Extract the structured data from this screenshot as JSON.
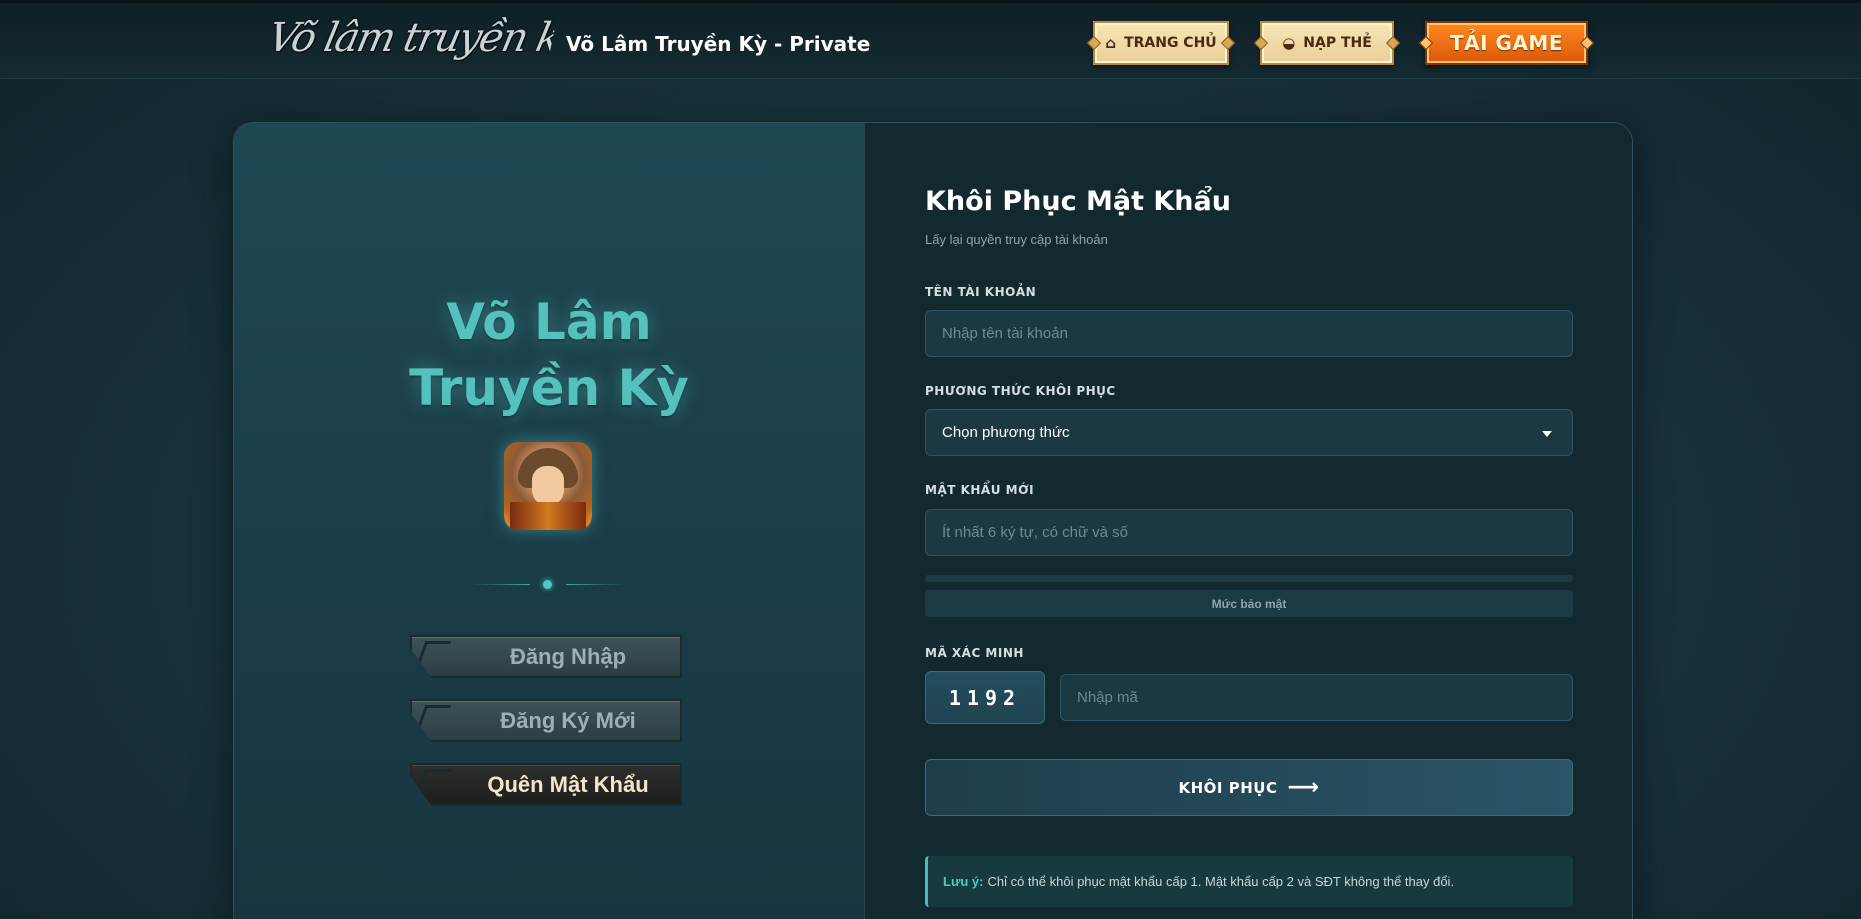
{
  "header": {
    "logo_text": "Võ lâm truyền kỳ",
    "site_title": "Võ Lâm Truyền Kỳ - Private",
    "nav": {
      "home": {
        "label": "TRANG CHỦ",
        "icon": "home-icon"
      },
      "topup": {
        "label": "NẠP THẺ",
        "icon": "ingot-icon"
      },
      "download": {
        "label": "TẢI GAME"
      }
    }
  },
  "sidebar": {
    "brand_line1": "Võ Lâm",
    "brand_line2": "Truyền Kỳ",
    "buttons": {
      "login": "Đăng Nhập",
      "register": "Đăng Ký Mới",
      "forgot": "Quên Mật Khẩu"
    }
  },
  "form": {
    "title": "Khôi Phục Mật Khẩu",
    "subtitle": "Lấy lại quyền truy cập tài khoản",
    "username": {
      "label": "TÊN TÀI KHOẢN",
      "placeholder": "Nhập tên tài khoản",
      "value": ""
    },
    "method": {
      "label": "PHƯƠNG THỨC KHÔI PHỤC",
      "selected": "Chọn phương thức"
    },
    "new_password": {
      "label": "MẬT KHẨU MỚI",
      "placeholder": "Ít nhất 6 ký tự, có chữ và số",
      "value": ""
    },
    "strength": {
      "label": "Mức bảo mật",
      "level": 0
    },
    "captcha": {
      "label": "MÃ XÁC MINH",
      "code": "1192",
      "placeholder": "Nhập mã",
      "value": ""
    },
    "submit_label": "KHÔI PHỤC",
    "note": {
      "key": "Lưu ý:",
      "text": "Chỉ có thể khôi phục mật khẩu cấp 1. Mật khẩu cấp 2 và SĐT không thể thay đổi."
    }
  },
  "colors": {
    "accent": "#54c1bd",
    "download_button": "#e8700f",
    "nav_button": "#f2dca6"
  }
}
